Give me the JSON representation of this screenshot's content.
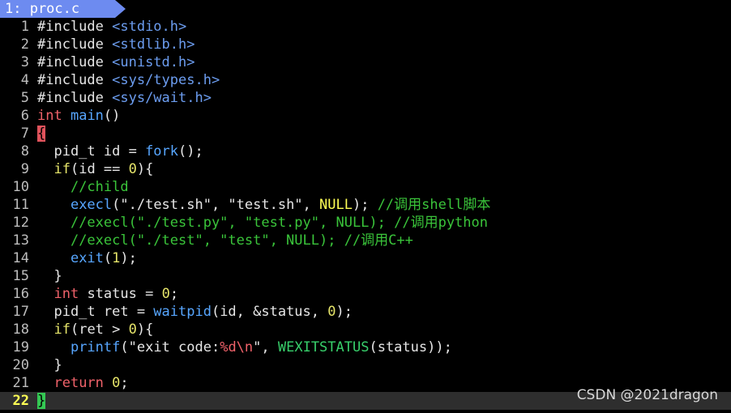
{
  "tab": {
    "label": "1: proc.c"
  },
  "watermark": "CSDN @2021dragon",
  "lines": [
    {
      "n": "1",
      "parts": [
        [
          "pp",
          "#include "
        ],
        [
          "inc",
          "<stdio.h>"
        ]
      ]
    },
    {
      "n": "2",
      "parts": [
        [
          "pp",
          "#include "
        ],
        [
          "inc",
          "<stdlib.h>"
        ]
      ]
    },
    {
      "n": "3",
      "parts": [
        [
          "pp",
          "#include "
        ],
        [
          "inc",
          "<unistd.h>"
        ]
      ]
    },
    {
      "n": "4",
      "parts": [
        [
          "pp",
          "#include "
        ],
        [
          "inc",
          "<sys/types.h>"
        ]
      ]
    },
    {
      "n": "5",
      "parts": [
        [
          "pp",
          "#include "
        ],
        [
          "inc",
          "<sys/wait.h>"
        ]
      ]
    },
    {
      "n": "6",
      "parts": [
        [
          "kw",
          "int"
        ],
        [
          "pp",
          " "
        ],
        [
          "fn",
          "main"
        ],
        [
          "pp",
          "()"
        ]
      ]
    },
    {
      "n": "7",
      "parts": [
        [
          "brace-red",
          "{"
        ]
      ]
    },
    {
      "n": "8",
      "parts": [
        [
          "pp",
          "  pid_t id = "
        ],
        [
          "fn",
          "fork"
        ],
        [
          "pp",
          "();"
        ]
      ]
    },
    {
      "n": "9",
      "parts": [
        [
          "pp",
          "  "
        ],
        [
          "num",
          "if"
        ],
        [
          "pp",
          "(id == "
        ],
        [
          "num",
          "0"
        ],
        [
          "pp",
          "){"
        ]
      ]
    },
    {
      "n": "10",
      "parts": [
        [
          "pp",
          "    "
        ],
        [
          "cmt",
          "//child"
        ]
      ]
    },
    {
      "n": "11",
      "parts": [
        [
          "pp",
          "    "
        ],
        [
          "fn",
          "execl"
        ],
        [
          "pp",
          "(\"./test.sh\", \"test.sh\", "
        ],
        [
          "nul",
          "NULL"
        ],
        [
          "pp",
          "); "
        ],
        [
          "cmt",
          "//调用shell脚本"
        ]
      ]
    },
    {
      "n": "12",
      "parts": [
        [
          "pp",
          "    "
        ],
        [
          "cmt",
          "//execl(\"./test.py\", \"test.py\", NULL); //调用python"
        ]
      ]
    },
    {
      "n": "13",
      "parts": [
        [
          "pp",
          "    "
        ],
        [
          "cmt",
          "//execl(\"./test\", \"test\", NULL); //调用C++"
        ]
      ]
    },
    {
      "n": "14",
      "parts": [
        [
          "pp",
          "    "
        ],
        [
          "fn",
          "exit"
        ],
        [
          "pp",
          "("
        ],
        [
          "num",
          "1"
        ],
        [
          "pp",
          ");"
        ]
      ]
    },
    {
      "n": "15",
      "parts": [
        [
          "pp",
          "  }"
        ]
      ]
    },
    {
      "n": "16",
      "parts": [
        [
          "pp",
          "  "
        ],
        [
          "kw",
          "int"
        ],
        [
          "pp",
          " status = "
        ],
        [
          "num",
          "0"
        ],
        [
          "pp",
          ";"
        ]
      ]
    },
    {
      "n": "17",
      "parts": [
        [
          "pp",
          "  pid_t ret = "
        ],
        [
          "fn",
          "waitpid"
        ],
        [
          "pp",
          "(id, &status, "
        ],
        [
          "num",
          "0"
        ],
        [
          "pp",
          ");"
        ]
      ]
    },
    {
      "n": "18",
      "parts": [
        [
          "pp",
          "  "
        ],
        [
          "num",
          "if"
        ],
        [
          "pp",
          "(ret > "
        ],
        [
          "num",
          "0"
        ],
        [
          "pp",
          "){"
        ]
      ]
    },
    {
      "n": "19",
      "parts": [
        [
          "pp",
          "    "
        ],
        [
          "fn",
          "printf"
        ],
        [
          "pp",
          "(\"exit code:"
        ],
        [
          "fmt",
          "%d\\n"
        ],
        [
          "pp",
          "\", "
        ],
        [
          "macro",
          "WEXITSTATUS"
        ],
        [
          "pp",
          "(status));"
        ]
      ]
    },
    {
      "n": "20",
      "parts": [
        [
          "pp",
          "  }"
        ]
      ]
    },
    {
      "n": "21",
      "parts": [
        [
          "pp",
          "  "
        ],
        [
          "kw",
          "return"
        ],
        [
          "pp",
          " "
        ],
        [
          "num",
          "0"
        ],
        [
          "pp",
          ";"
        ]
      ]
    },
    {
      "n": "22",
      "parts": [
        [
          "brace-green",
          "}"
        ]
      ],
      "current": true
    }
  ]
}
